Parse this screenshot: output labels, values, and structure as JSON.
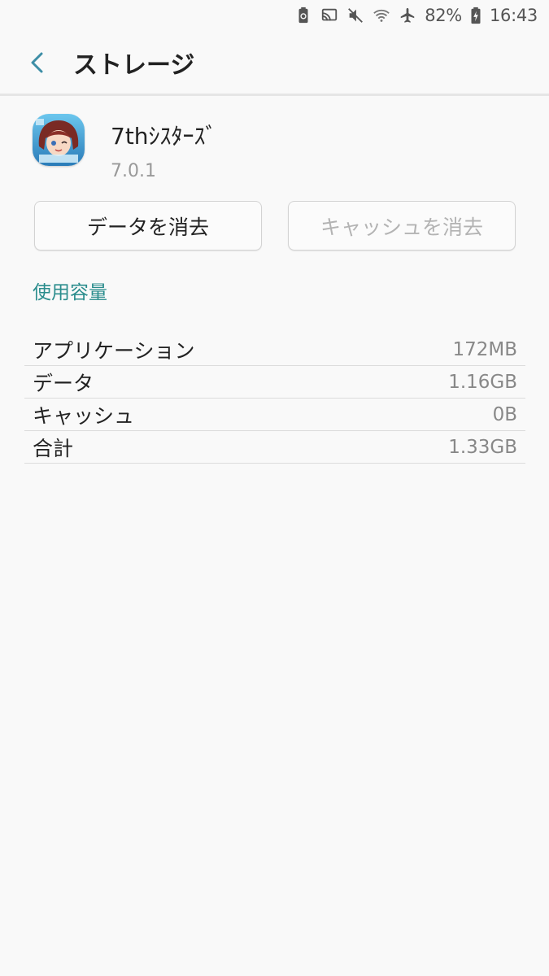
{
  "status_bar": {
    "icons": [
      "battery-saver-icon",
      "cast-icon",
      "mute-icon",
      "wifi-icon",
      "airplane-icon",
      "battery-icon"
    ],
    "battery": "82%",
    "time": "16:43"
  },
  "header": {
    "back_icon": "chevron-left-icon",
    "title": "ストレージ"
  },
  "app": {
    "name": "7thｼｽﾀｰｽﾞ",
    "version": "7.0.1"
  },
  "buttons": {
    "clear_data": "データを消去",
    "clear_cache": "キャッシュを消去"
  },
  "section": {
    "title": "使用容量"
  },
  "storage": {
    "rows": [
      {
        "label": "アプリケーション",
        "value": "172MB"
      },
      {
        "label": "データ",
        "value": "1.16GB"
      },
      {
        "label": "キャッシュ",
        "value": "0B"
      },
      {
        "label": "合計",
        "value": "1.33GB"
      }
    ]
  },
  "colors": {
    "accent": "#2b8d8d",
    "background": "#f9f9f9",
    "back_arrow": "#3d8ea6"
  }
}
